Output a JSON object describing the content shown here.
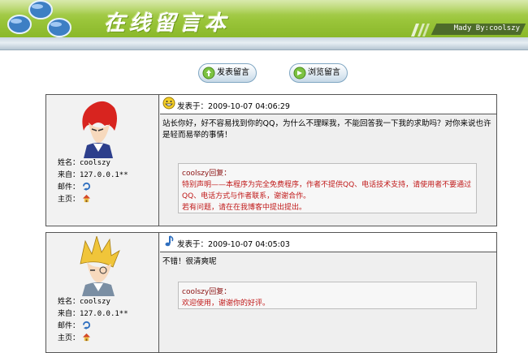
{
  "header": {
    "title": "在线留言本",
    "author": "Mady By:coolszy"
  },
  "actions": {
    "post_label": "发表留言",
    "browse_label": "浏览留言"
  },
  "labels": {
    "name": "姓名：",
    "from": "来自：",
    "email": "邮件：",
    "homepage": "主页：",
    "posted_at": "发表于："
  },
  "messages": [
    {
      "face": "grinning-face-icon",
      "avatar": "red-haired-anime-avatar",
      "name": "coolszy",
      "from": "127.0.0.1**",
      "time": "2009-10-07 04:06:29",
      "content": "站长你好，好不容易找到你的QQ，为什么不理睬我，不能回答我一下我的求助吗？对你来说也许是轻而易举的事情！",
      "reply": {
        "header": "coolszy回复：",
        "lines": [
          "特别声明——本程序为完全免费程序，作者不提供QQ、电话技术支持，请使用者不要通过QQ、电话方式与作者联系，谢谢合作。",
          "若有问题，请在在我博客中提出提出。"
        ]
      }
    },
    {
      "face": "music-note-icon",
      "avatar": "blonde-haired-anime-avatar",
      "name": "coolszy",
      "from": "127.0.0.1**",
      "time": "2009-10-07 04:05:03",
      "content": "不错！很清爽呢",
      "reply": {
        "header": "coolszy回复：",
        "lines": [
          "欢迎使用，谢谢你的好评。"
        ]
      }
    }
  ]
}
